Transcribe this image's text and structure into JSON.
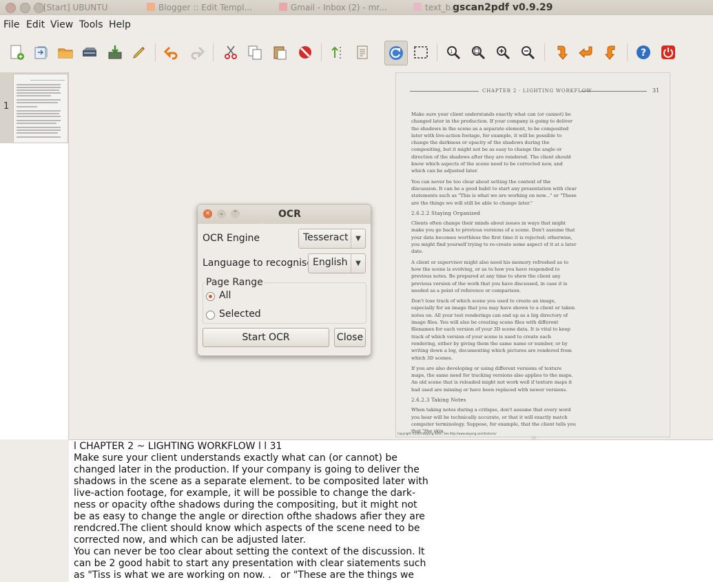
{
  "window": {
    "title": "gscan2pdf v0.9.29",
    "background_tabs": [
      "[Start] UBUNTU",
      "Blogger :: Edit Templ...",
      "Gmail - Inbox (2) - mr...",
      "text_b..."
    ]
  },
  "menu": [
    "File",
    "Edit",
    "View",
    "Tools",
    "Help"
  ],
  "toolbar": {
    "icons": [
      "new-document-icon",
      "import-icon",
      "open-folder-icon",
      "scan-icon",
      "save-icon",
      "edit-pen-icon",
      "undo-icon",
      "redo-icon",
      "cut-icon",
      "copy-icon",
      "paste-icon",
      "delete-icon",
      "renumber-icon",
      "properties-icon",
      "rotate-icon",
      "select-icon",
      "zoom-100-icon",
      "zoom-fit-icon",
      "zoom-in-icon",
      "zoom-out-icon",
      "rotate-90-icon",
      "rotate-180-icon",
      "rotate-270-icon",
      "help-icon",
      "quit-icon"
    ]
  },
  "thumbnails": [
    {
      "number": "1"
    }
  ],
  "page": {
    "header": "CHAPTER 2  ·  LIGHTING WORKFLOW",
    "page_number": "31",
    "paragraphs": [
      "Make sure your client understands exactly what can (or cannot) be changed later in the production. If your company is going to deliver the shadows in the scene as a separate element, to be composited later with live-action footage, for example, it will be possible to change the darkness or opacity of the shadows during the compositing, but it might not be as easy to change the angle or direction of the shadows after they are rendered. The client should know which aspects of the scene need to be corrected now, and which can be adjusted later.",
      "You can never be too clear about setting the context of the discussion. It can be a good habit to start any presentation with clear statements such as \"This is what we are working on now...\" or \"These are the things we will still be able to change later.\""
    ],
    "subheading_1": "2.6.2.2  Staying Organized",
    "paragraphs_2": [
      "Clients often change their minds about issues in ways that might make you go back to previous versions of a scene. Don't assume that your data becomes worthless the first time it is rejected; otherwise, you might find yourself trying to re-create some aspect of it at a later date.",
      "A client or supervisor might also need his memory refreshed as to how the scene is evolving, or as to how you have responded to previous notes. Be prepared at any time to show the client any previous version of the work that you have discussed, in case it is needed as a point of reference or comparison.",
      "Don't lose track of which scene you used to create an image, especially for an image that you may have shown to a client or taken notes on. All your test renderings can end up as a big directory of image files. You will also be creating scene files with different filenames for each version of your 3D scene data. It is vital to keep track of which version of your scene is used to create each rendering, either by giving them the same name or number, or by writing down a log, documenting which pictures are rendered from which 3D scenes.",
      "If you are also developing or using different versions of texture maps, the same need for tracking versions also applies to the maps. An old scene that is reloaded might not work well if texture maps it had used are missing or have been replaced with newer versions."
    ],
    "subheading_2": "2.6.2.3  Taking Notes",
    "paragraphs_3": [
      "When taking notes during a critique, don't assume that every word you hear will be technically accurate, or that it will exactly match computer terminology. Suppose, for example, that the client tells you that \"the skin"
    ],
    "footer": "Copyright ©2004 Wayang Ashin.  See http://www.wayang.com/textures/"
  },
  "ocr_dialog": {
    "title": "OCR",
    "engine_label": "OCR Engine",
    "engine_value": "Tesseract",
    "language_label": "Language to recognise",
    "language_value": "English",
    "page_range_label": "Page Range",
    "option_all": "All",
    "option_selected": "Selected",
    "selected_option": "All",
    "start_button": "Start OCR",
    "close_button": "Close"
  },
  "ocr_output": "l CHAPTER 2 ~ LIGHTING WORKFLOW l l 31\nMake sure your client understands exactly what can (or cannot) be\nchanged later in the production. If your company is going to deliver the\nshadows in the scene as a separate element. to be composited later with\nlive-action footage, for example, it will be possible to change the dark-\nness or opacity ofthe shadows during the compositing, but it might not\nbe as easy to change the angle or direction ofthe shadows afier they are\nrendcred.The client should know which aspects of the scene need to be\ncorrected now, and which can be adjusted later.\nYou can never be too clear about setting the context of the discussion. lt\ncan be 2 good habit to start any presentation with clear siatements such\nas \"Tiss is what we are working on now. .   or \"These are the things we"
}
